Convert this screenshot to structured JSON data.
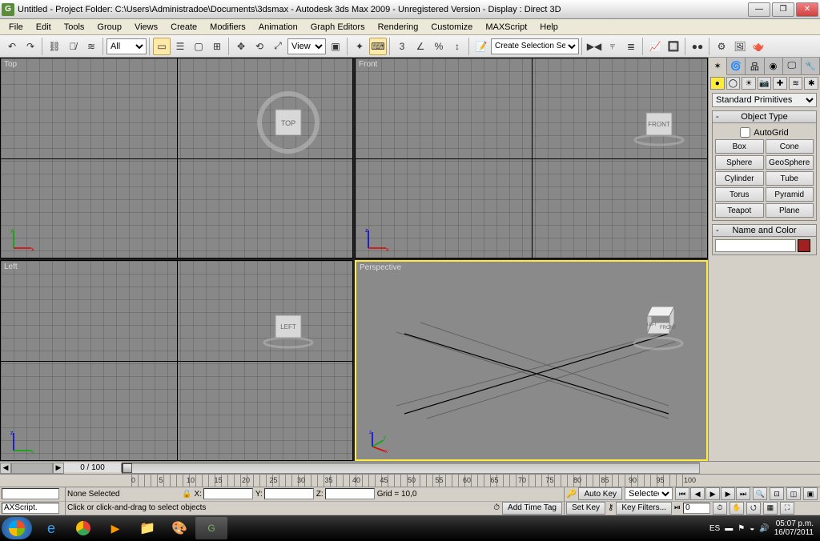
{
  "title": "Untitled    - Project Folder: C:\\Users\\Administradoe\\Documents\\3dsmax    - Autodesk 3ds Max  2009  - Unregistered Version     - Display : Direct 3D",
  "menu": [
    "File",
    "Edit",
    "Tools",
    "Group",
    "Views",
    "Create",
    "Modifiers",
    "Animation",
    "Graph Editors",
    "Rendering",
    "Customize",
    "MAXScript",
    "Help"
  ],
  "toolbar": {
    "filter": "All",
    "view": "View",
    "selset": "Create Selection Set"
  },
  "cmdpanel": {
    "dropdown": "Standard Primitives",
    "rollouts": {
      "object_type": "Object Type",
      "autogrid": "AutoGrid",
      "name_color": "Name and Color"
    },
    "primitives": [
      "Box",
      "Cone",
      "Sphere",
      "GeoSphere",
      "Cylinder",
      "Tube",
      "Torus",
      "Pyramid",
      "Teapot",
      "Plane"
    ]
  },
  "viewports": {
    "tl": "Top",
    "tr": "Front",
    "bl": "Left",
    "br": "Perspective",
    "cube_top": "TOP",
    "cube_front": "FRONT",
    "cube_left": "LEFT"
  },
  "timeline": {
    "pos": "0 / 100",
    "ticks": [
      "0",
      "5",
      "10",
      "15",
      "20",
      "25",
      "30",
      "35",
      "40",
      "45",
      "50",
      "55",
      "60",
      "65",
      "70",
      "75",
      "80",
      "85",
      "90",
      "95",
      "100"
    ]
  },
  "status": {
    "maxscript": "AXScript.",
    "none_selected": "None Selected",
    "prompt": "Click  or click-and-drag to select objects",
    "x": "X:",
    "y": "Y:",
    "z": "Z:",
    "grid": "Grid = 10,0",
    "addtag": "Add Time Tag",
    "autokey": "Auto Key",
    "setkey": "Set Key",
    "selected": "Selected",
    "keyfilters": "Key Filters...",
    "framefield": "0"
  },
  "tray": {
    "lang": "ES",
    "time": "05:07 p.m.",
    "date": "16/07/2011"
  }
}
